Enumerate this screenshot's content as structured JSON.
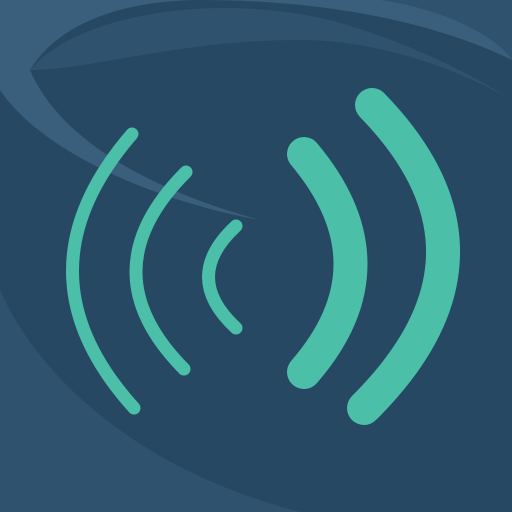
{
  "icon": {
    "name": "signal-waves-icon",
    "colors": {
      "background": "#264863",
      "background_highlight": "#3a5f7c",
      "background_highlight_soft": "#2f526e",
      "wave": "#4bbfa8"
    }
  }
}
